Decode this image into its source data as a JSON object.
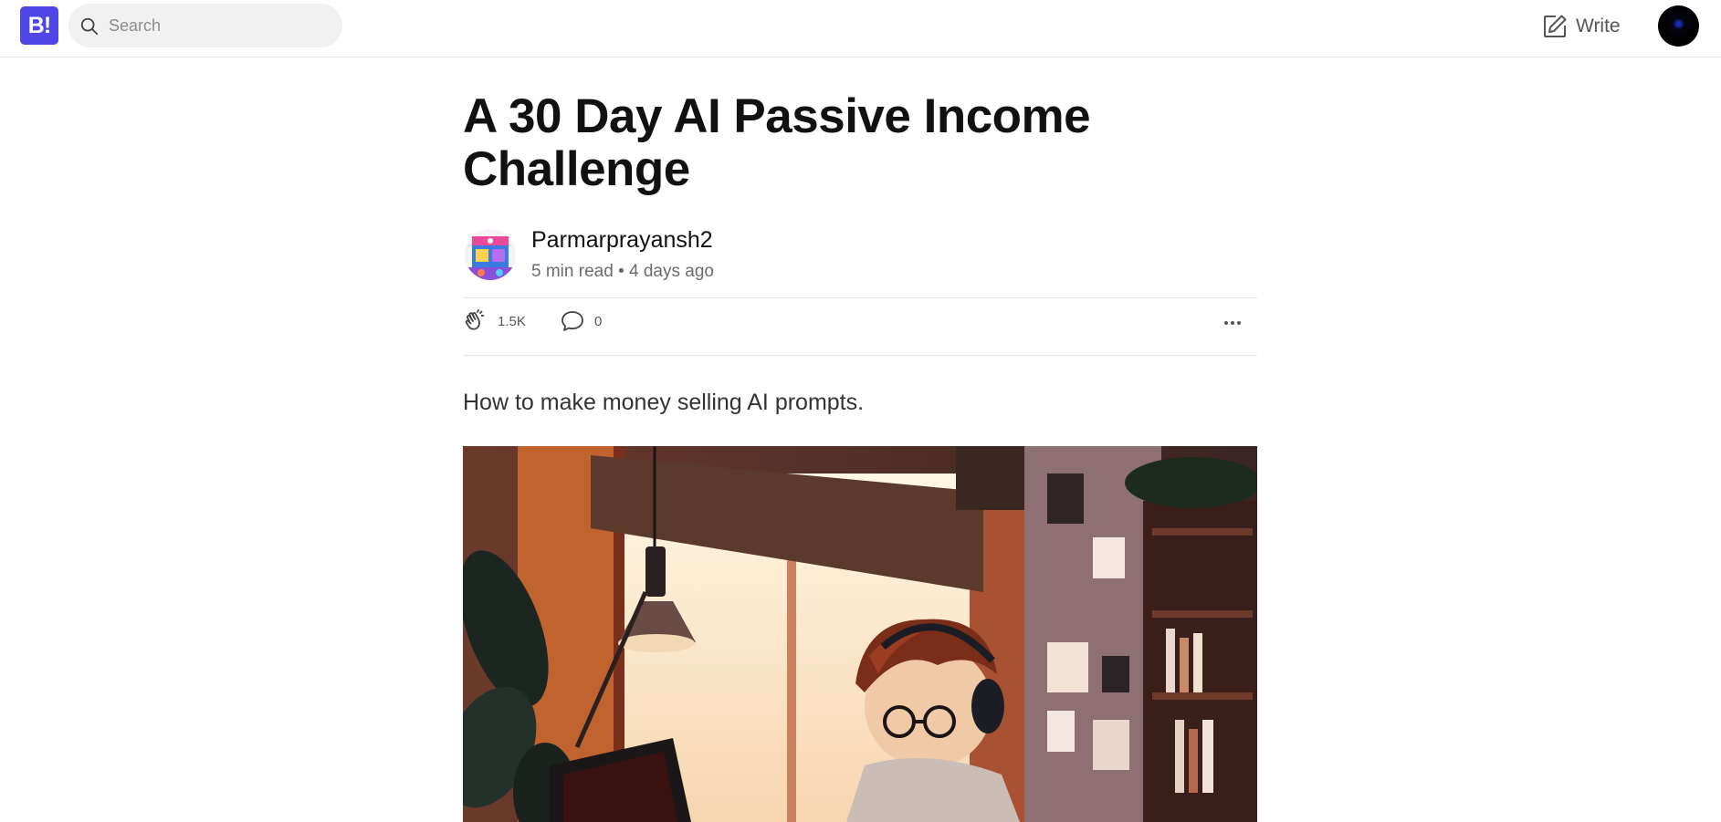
{
  "nav": {
    "logo_text": "B!",
    "search_placeholder": "Search",
    "write_label": "Write",
    "brand_color": "#5046e5"
  },
  "article": {
    "title": "A 30 Day AI Passive Income Challenge",
    "author": {
      "name": "Parmarprayansh2",
      "read_time": "5 min read",
      "separator": "•",
      "posted": "4 days ago"
    },
    "actions": {
      "clap_count": "1.5K",
      "comment_count": "0"
    },
    "subtitle": "How to make money selling AI prompts.",
    "hero_image": "illustration of a person with headphones and glasses working at a laptop under a desk lamp by a window"
  },
  "icons": {
    "search": "search-icon",
    "write": "edit-icon",
    "clap": "clap-icon",
    "comment": "comment-icon",
    "more": "more-icon"
  }
}
